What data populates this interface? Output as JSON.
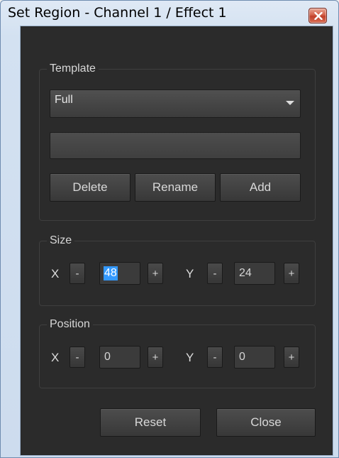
{
  "window": {
    "title": "Set Region - Channel 1 / Effect 1"
  },
  "template": {
    "label": "Template",
    "selected": "Full",
    "name_value": "",
    "delete_label": "Delete",
    "rename_label": "Rename",
    "add_label": "Add"
  },
  "size": {
    "label": "Size",
    "x_label": "X",
    "y_label": "Y",
    "x_value": "48",
    "y_value": "24",
    "minus": "-",
    "plus": "+"
  },
  "position": {
    "label": "Position",
    "x_label": "X",
    "y_label": "Y",
    "x_value": "0",
    "y_value": "0",
    "minus": "-",
    "plus": "+"
  },
  "footer": {
    "reset_label": "Reset",
    "close_label": "Close"
  },
  "icons": {
    "close": "close-icon",
    "dropdown": "chevron-down-icon"
  },
  "colors": {
    "panel_bg": "#2b2b2b",
    "selection": "#3399ff",
    "close_button": "#c0402a"
  }
}
